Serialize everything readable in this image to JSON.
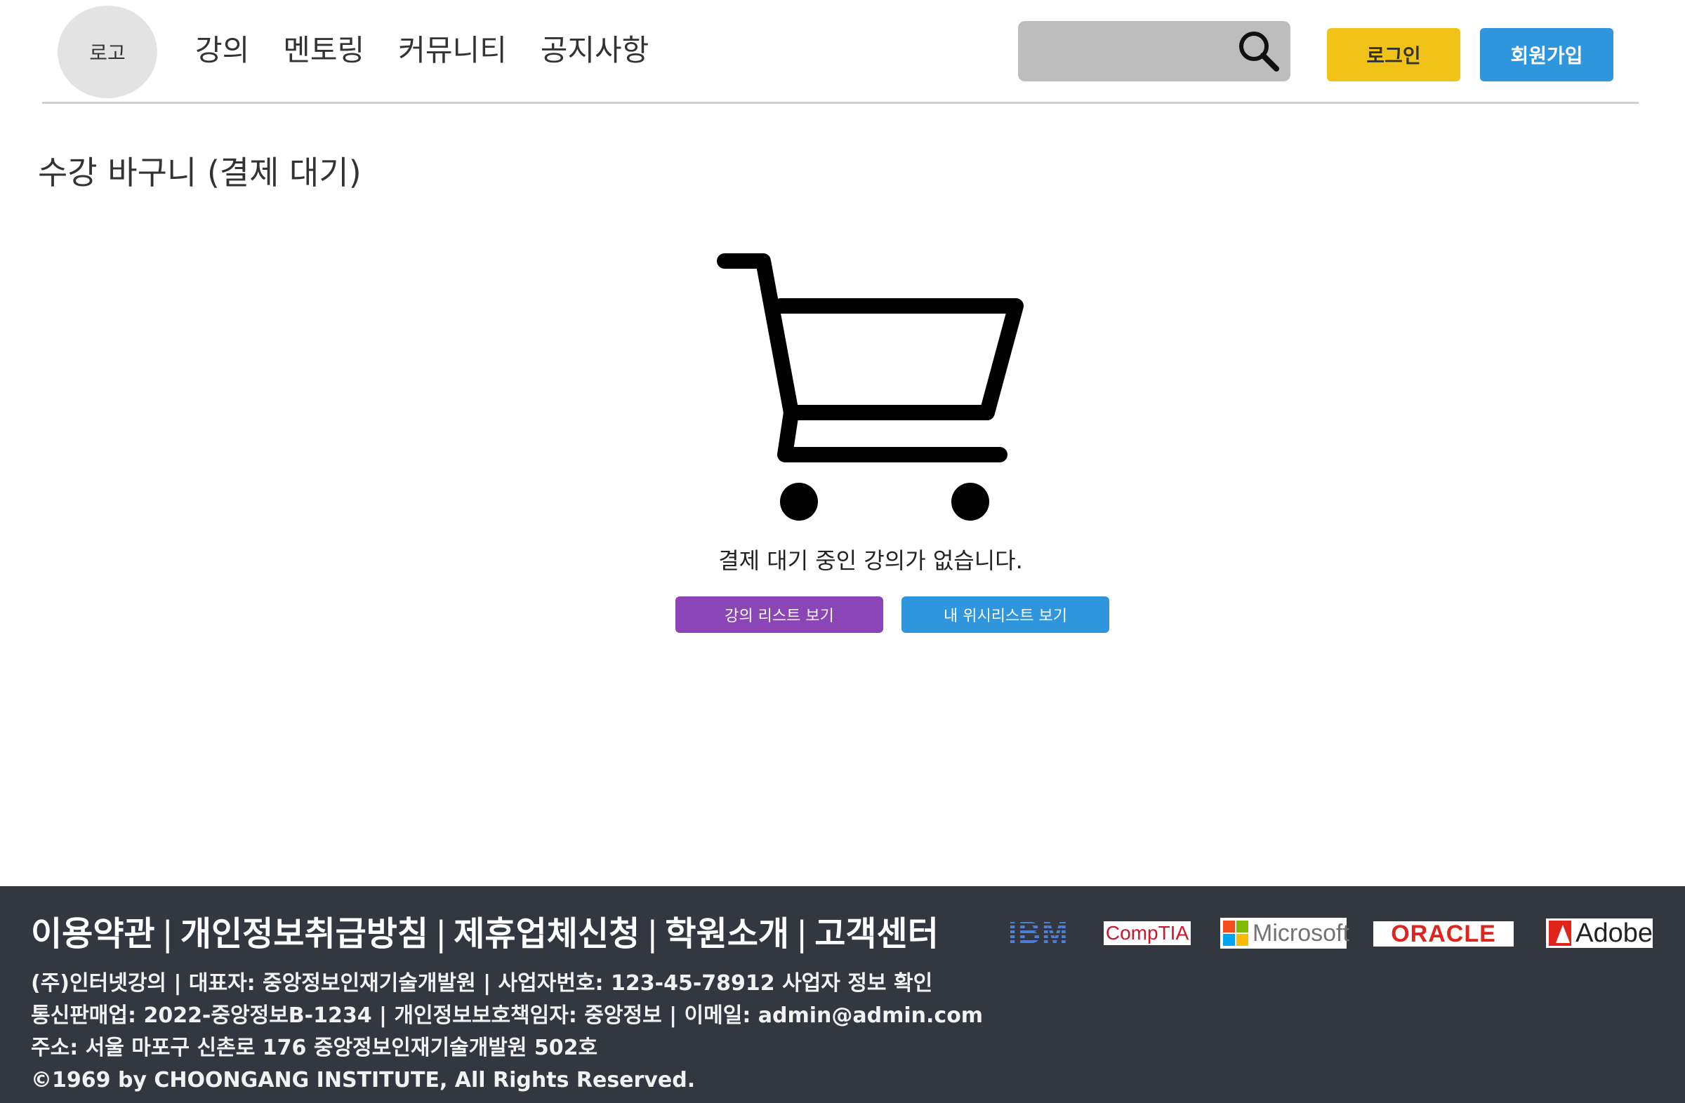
{
  "header": {
    "logo": "로고",
    "nav": [
      "강의",
      "멘토링",
      "커뮤니티",
      "공지사항"
    ],
    "search_placeholder": "",
    "login_label": "로그인",
    "signup_label": "회원가입"
  },
  "main": {
    "title": "수강 바구니 (결제 대기)",
    "empty_message": "결제 대기 중인 강의가 없습니다.",
    "course_list_button": "강의 리스트 보기",
    "wishlist_button": "내 위시리스트 보기"
  },
  "footer": {
    "links": [
      "이용약관",
      "개인정보취급방침",
      "제휴업체신청",
      "학원소개",
      "고객센터"
    ],
    "info_lines": [
      "(주)인터넷강의 | 대표자: 중앙정보인재기술개발원 | 사업자번호: 123-45-78912 사업자 정보 확인",
      "통신판매업: 2022-중앙정보B-1234 | 개인정보보호책임자: 중앙정보 | 이메일: admin@admin.com",
      "주소: 서울 마포구 신촌로 176 중앙정보인재기술개발원 502호",
      "©1969 by CHOONGANG INSTITUTE, All Rights Reserved."
    ],
    "partners": [
      "IBM",
      "CompTIA",
      "Microsoft",
      "ORACLE",
      "Adobe"
    ]
  },
  "colors": {
    "login": "#f1c218",
    "signup": "#2f95dc",
    "course_list_button": "#8b45b6",
    "wishlist_button": "#2f95dc",
    "footer_bg": "#333740",
    "search_bg": "#bdbdbd"
  },
  "icons": [
    "search-icon",
    "cart-icon"
  ]
}
